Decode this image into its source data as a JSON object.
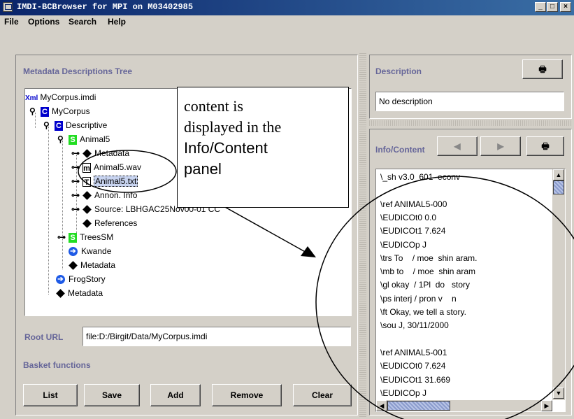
{
  "window": {
    "title": "IMDI-BCBrowser for MPI on M03402985",
    "minimize": "_",
    "maximize": "□",
    "close": "×"
  },
  "menubar": {
    "items": [
      "File",
      "Options",
      "Search",
      "Help"
    ]
  },
  "tree_panel": {
    "title": "Metadata Descriptions Tree",
    "nodes": {
      "root": "MyCorpus.imdi",
      "root_badge": "Xml",
      "corpus": "MyCorpus",
      "descriptive": "Descriptive",
      "animal5": "Animal5",
      "metadata1": "Metadata",
      "wav": "Animal5.wav",
      "txt": "Animal5.txt",
      "annon": "Annon. Info",
      "source": "Source: LBHGAC25Nov00-01 CC",
      "references": "References",
      "treessm": "TreesSM",
      "kwande": "Kwande",
      "metadata2": "Metadata",
      "frogstory": "FrogStory",
      "metadata3": "Metadata"
    },
    "icon_letters": {
      "c": "C",
      "s": "S",
      "m": "m",
      "t": "T"
    }
  },
  "root_url": {
    "label": "Root URL",
    "value": "file:D:/Birgit/Data/MyCorpus.imdi"
  },
  "basket": {
    "title": "Basket functions",
    "buttons": [
      "List",
      "Save",
      "Add",
      "Remove",
      "Clear"
    ]
  },
  "description": {
    "title": "Description",
    "text": "No description"
  },
  "info": {
    "title": "Info/Content",
    "lines": [
      "\\_sh v3.0  601  econv",
      "",
      "\\ref ANIMAL5-000",
      "\\EUDICOt0 0.0",
      "\\EUDICOt1 7.624",
      "\\EUDICOp J",
      "\\trs To    / moe  shin aram.",
      "\\mb to    / moe  shin aram",
      "\\gl okay  / 1Pl  do   story",
      "\\ps interj / pron v    n",
      "\\ft Okay, we tell a story.",
      "\\sou J, 30/11/2000",
      "",
      "\\ref ANIMAL5-001",
      "\\EUDICOt0 7.624",
      "\\EUDICOt1 31.669",
      "\\EUDICOp J"
    ]
  },
  "callout": {
    "lines": [
      "content is",
      "displayed in the",
      "Info/Content",
      "panel"
    ]
  },
  "colors": {
    "title_blue": "#0a246a",
    "panel_title": "#666699",
    "corpus_icon": "#0000cc",
    "session_icon": "#22dd22"
  }
}
